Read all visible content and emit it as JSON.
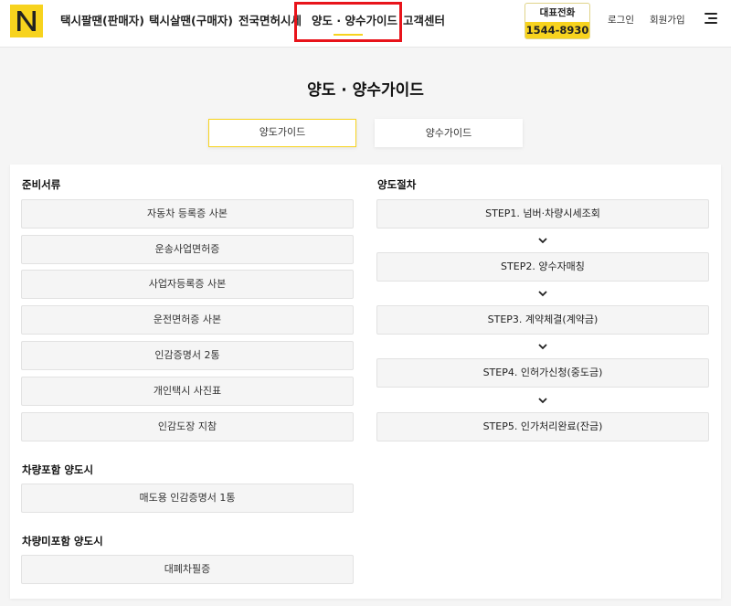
{
  "header": {
    "nav": [
      {
        "label": "택시팔땐(판매자)"
      },
      {
        "label": "택시살땐(구매자)"
      },
      {
        "label": "전국면허시세"
      },
      {
        "label": "양도 · 양수가이드"
      },
      {
        "label": "고객센터"
      }
    ],
    "phone": {
      "label": "대표전화",
      "number": "1544-8930"
    },
    "login": "로그인",
    "signup": "회원가입",
    "colors": {
      "brand": "#f7d31e",
      "highlight": "#e8141b"
    }
  },
  "page": {
    "title": "양도 · 양수가이드",
    "tabs": [
      {
        "label": "양도가이드",
        "active": true
      },
      {
        "label": "양수가이드",
        "active": false
      }
    ]
  },
  "documents": {
    "heading": "준비서류",
    "items": [
      "자동차 등록증 사본",
      "운송사업면허증",
      "사업자등록증 사본",
      "운전면허증 사본",
      "인감증명서 2통",
      "개인택시 사진표",
      "인감도장 지참"
    ],
    "with_vehicle": {
      "heading": "차량포함 양도시",
      "items": [
        "매도용 인감증명서 1통"
      ]
    },
    "without_vehicle": {
      "heading": "차량미포함 양도시",
      "items": [
        "대폐차필증"
      ]
    }
  },
  "procedure": {
    "heading": "양도절차",
    "steps": [
      "STEP1. 넘버·차량시세조회",
      "STEP2. 양수자매칭",
      "STEP3. 계약체결(계약금)",
      "STEP4. 인허가신청(중도금)",
      "STEP5. 인가처리완료(잔금)"
    ]
  }
}
